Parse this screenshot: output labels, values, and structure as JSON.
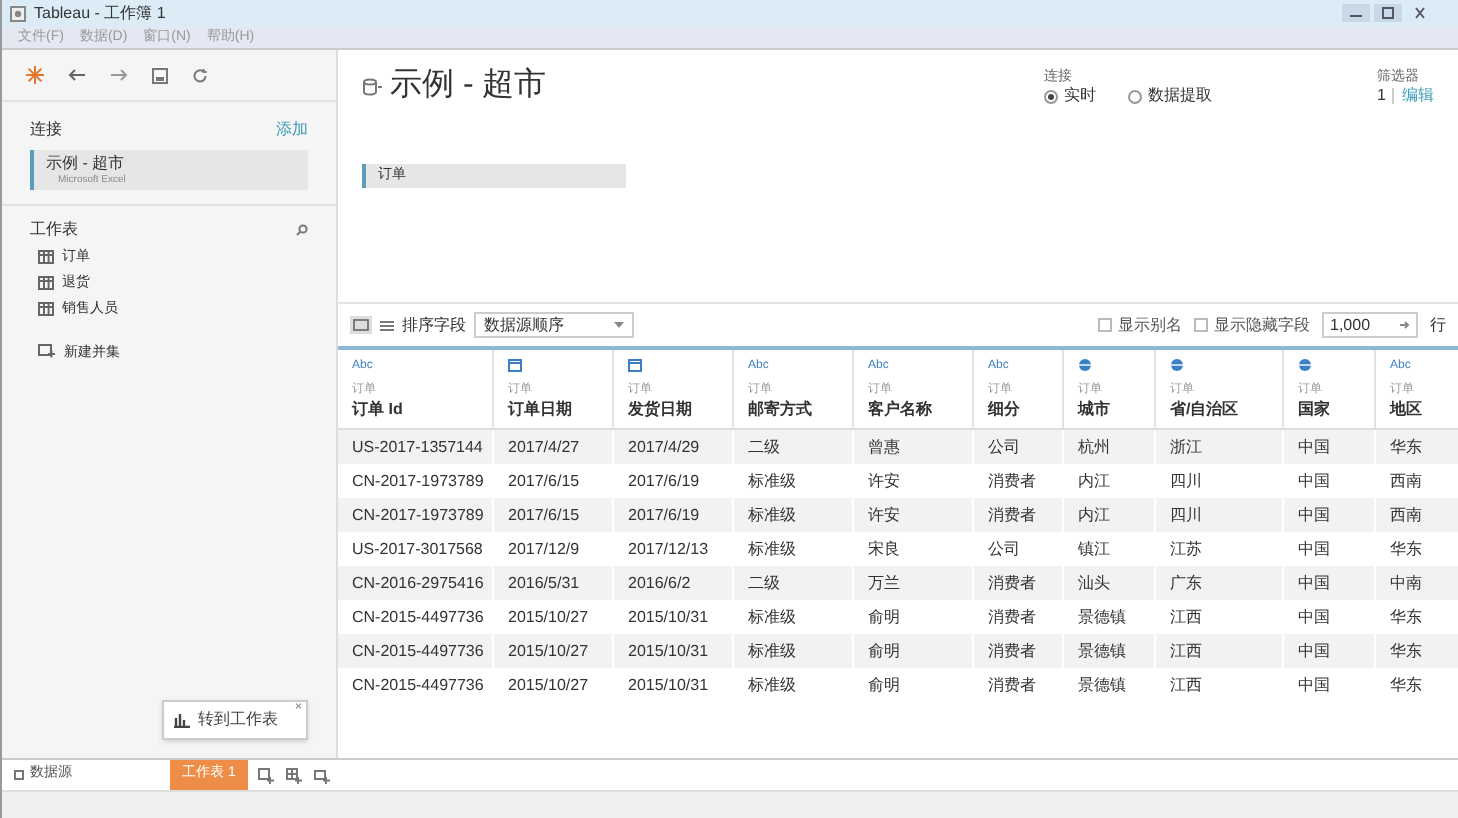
{
  "window": {
    "title": "Tableau - 工作簿 1"
  },
  "menu": [
    "文件(F)",
    "数据(D)",
    "窗口(N)",
    "帮助(H)"
  ],
  "sidebar": {
    "connections_label": "连接",
    "add_link": "添加",
    "connection": {
      "name": "示例 - 超市",
      "type": "Microsoft Excel",
      "selected": true
    },
    "sheets_label": "工作表",
    "sheets": [
      {
        "label": "订单",
        "kind": "table"
      },
      {
        "label": "退货",
        "kind": "table"
      },
      {
        "label": "销售人员",
        "kind": "table"
      },
      {
        "label": "新建并集",
        "kind": "union"
      }
    ]
  },
  "datasource": {
    "title": "示例 - 超市",
    "connection_label": "连接",
    "connection_options": [
      {
        "label": "实时",
        "selected": true
      },
      {
        "label": "数据提取",
        "selected": false
      }
    ],
    "filters_label": "筛选器",
    "filters_count": "1",
    "filters_edit": "编辑",
    "canvas_table": "订单"
  },
  "grid_toolbar": {
    "sort_label": "排序字段",
    "sort_value": "数据源顺序",
    "checkboxes": [
      {
        "label": "显示别名",
        "checked": false
      },
      {
        "label": "显示隐藏字段",
        "checked": false
      }
    ],
    "rows_value": "1,000",
    "rows_label": "行"
  },
  "table": {
    "columns": [
      {
        "kind": "text",
        "type_label": "Abc",
        "source": "订单",
        "name": "订单 Id"
      },
      {
        "kind": "date",
        "source": "订单",
        "name": "订单日期"
      },
      {
        "kind": "date",
        "source": "订单",
        "name": "发货日期"
      },
      {
        "kind": "text",
        "type_label": "Abc",
        "source": "订单",
        "name": "邮寄方式"
      },
      {
        "kind": "text",
        "type_label": "Abc",
        "source": "订单",
        "name": "客户名称"
      },
      {
        "kind": "text",
        "type_label": "Abc",
        "source": "订单",
        "name": "细分"
      },
      {
        "kind": "geo",
        "source": "订单",
        "name": "城市"
      },
      {
        "kind": "geo",
        "source": "订单",
        "name": "省/自治区"
      },
      {
        "kind": "geo",
        "source": "订单",
        "name": "国家"
      },
      {
        "kind": "text",
        "type_label": "Abc",
        "source": "订单",
        "name": "地区"
      }
    ],
    "rows": [
      [
        "US-2017-1357144",
        "2017/4/27",
        "2017/4/29",
        "二级",
        "曾惠",
        "公司",
        "杭州",
        "浙江",
        "中国",
        "华东"
      ],
      [
        "CN-2017-1973789",
        "2017/6/15",
        "2017/6/19",
        "标准级",
        "许安",
        "消费者",
        "内江",
        "四川",
        "中国",
        "西南"
      ],
      [
        "CN-2017-1973789",
        "2017/6/15",
        "2017/6/19",
        "标准级",
        "许安",
        "消费者",
        "内江",
        "四川",
        "中国",
        "西南"
      ],
      [
        "US-2017-3017568",
        "2017/12/9",
        "2017/12/13",
        "标准级",
        "宋良",
        "公司",
        "镇江",
        "江苏",
        "中国",
        "华东"
      ],
      [
        "CN-2016-2975416",
        "2016/5/31",
        "2016/6/2",
        "二级",
        "万兰",
        "消费者",
        "汕头",
        "广东",
        "中国",
        "中南"
      ],
      [
        "CN-2015-4497736",
        "2015/10/27",
        "2015/10/31",
        "标准级",
        "俞明",
        "消费者",
        "景德镇",
        "江西",
        "中国",
        "华东"
      ],
      [
        "CN-2015-4497736",
        "2015/10/27",
        "2015/10/31",
        "标准级",
        "俞明",
        "消费者",
        "景德镇",
        "江西",
        "中国",
        "华东"
      ],
      [
        "CN-2015-4497736",
        "2015/10/27",
        "2015/10/31",
        "标准级",
        "俞明",
        "消费者",
        "景德镇",
        "江西",
        "中国",
        "华东"
      ]
    ]
  },
  "tooltip": {
    "label": "转到工作表",
    "close": "×"
  },
  "bottom_tabs": [
    {
      "label": "数据源",
      "kind": "datasource",
      "selected": false
    },
    {
      "label": "工作表 1",
      "kind": "sheet",
      "selected": true
    }
  ]
}
